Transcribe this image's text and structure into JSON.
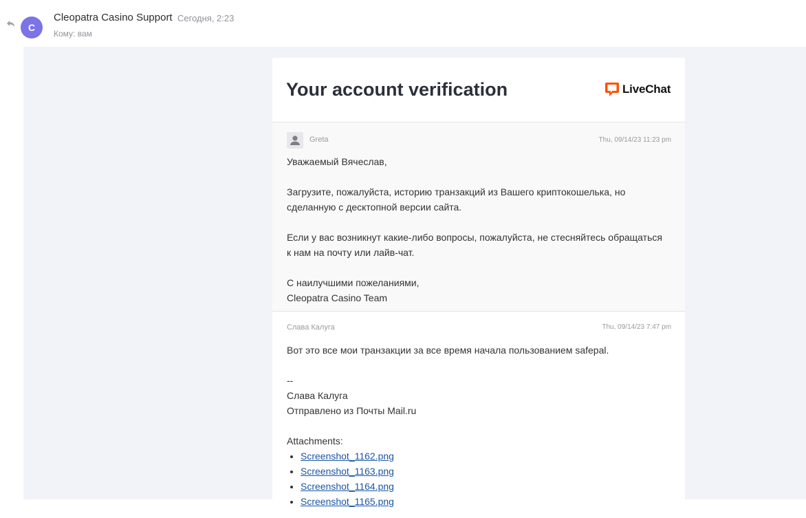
{
  "email": {
    "avatar_letter": "C",
    "sender": "Cleopatra Casino Support",
    "date": "Сегодня, 2:23",
    "to_label": "Кому:",
    "to_value": "вам",
    "avatar_color": "#7b73e6"
  },
  "card": {
    "title": "Your account verification",
    "brand": "LiveChat",
    "brand_color": "#ff5100"
  },
  "message1": {
    "author": "Greta",
    "time": "Thu, 09/14/23 11:23 pm",
    "lines": [
      "Уважаемый Вячеслав,",
      "",
      "Загрузите, пожалуйста, историю транзакций из Вашего криптокошелька, но",
      "сделанную с десктопной версии сайта.",
      "",
      "Если у вас возникнут какие-либо вопросы, пожалуйста, не стесняйтесь обращаться",
      "к нам на почту или лайв-чат.",
      "",
      "С наилучшими пожеланиями,",
      "Cleopatra Casino Team"
    ]
  },
  "message2": {
    "author": "Слава Калуга",
    "time": "Thu, 09/14/23 7:47 pm",
    "lines": [
      "Вот это все мои транзакции за все время начала пользованием safepal.",
      "",
      "--",
      "Слава Калуга",
      "Отправлено из Почты Mail.ru",
      "",
      "Attachments:"
    ],
    "attachments": [
      "Screenshot_1162.png",
      "Screenshot_1163.png",
      "Screenshot_1164.png",
      "Screenshot_1165.png"
    ]
  }
}
